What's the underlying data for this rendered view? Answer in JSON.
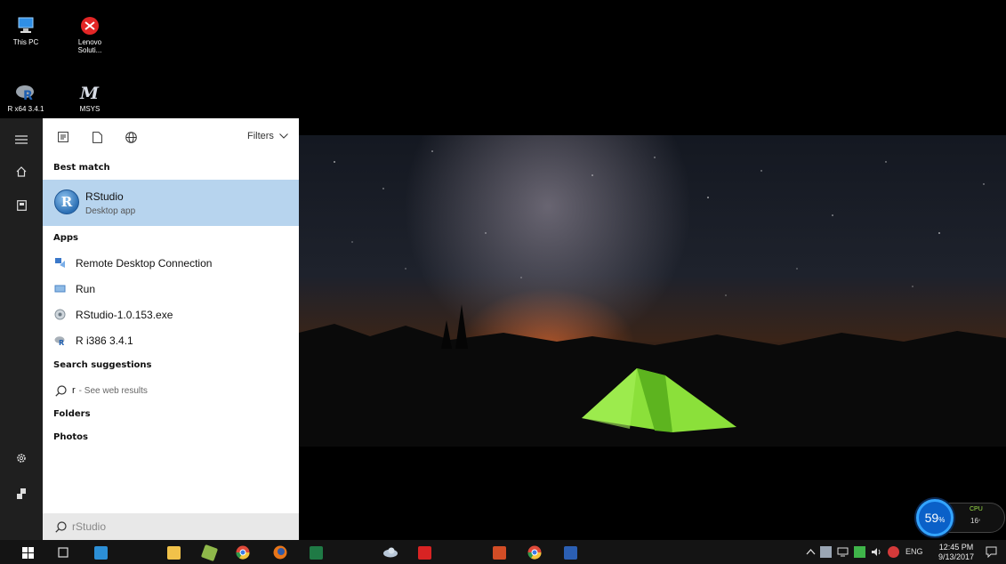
{
  "desktop_icons": [
    {
      "label": "This PC",
      "icon": "this-pc-icon"
    },
    {
      "label": "Lenovo Soluti...",
      "icon": "lenovo-solutions-icon"
    },
    {
      "label": "R x64 3.4.1",
      "icon": "r-icon"
    },
    {
      "label": "MSYS",
      "icon": "msys-icon"
    }
  ],
  "start_menu": {
    "rail": [
      "hamburger-icon",
      "home-icon",
      "documents-icon",
      "settings-icon",
      "user-icon"
    ],
    "filter_tabs": [
      "apps-filter-icon",
      "documents-filter-icon",
      "web-filter-icon"
    ],
    "filters_label": "Filters",
    "best_match_heading": "Best match",
    "best_match": {
      "title": "RStudio",
      "subtitle": "Desktop app"
    },
    "apps_heading": "Apps",
    "apps": [
      {
        "label": "Remote Desktop Connection",
        "icon": "remote-desktop-icon"
      },
      {
        "label": "Run",
        "icon": "run-icon"
      },
      {
        "label": "RStudio-1.0.153.exe",
        "icon": "installer-icon"
      },
      {
        "label": "R i386 3.4.1",
        "icon": "r-icon"
      }
    ],
    "search_suggestions_heading": "Search suggestions",
    "web_suggestion": {
      "query": "r",
      "suffix": "- See web results"
    },
    "folders_heading": "Folders",
    "photos_heading": "Photos",
    "search_box": {
      "value": "rStudio"
    }
  },
  "cpu_widget": {
    "percent": "59",
    "percent_unit": "%",
    "label": "CPU",
    "temp": "16",
    "temp_unit": "°"
  },
  "taskbar": {
    "apps": [
      "start-button",
      "task-view",
      "media-player",
      "file-explorer",
      "clipboard-app",
      "chrome",
      "firefox",
      "excel",
      "cloud-app",
      "acrobat",
      "powerpoint",
      "chrome-2",
      "word"
    ],
    "tray_language": "ENG",
    "time": "12:45 PM",
    "date": "9/13/2017"
  },
  "colors": {
    "menu_bg": "#ffffff",
    "rail_bg": "#1f1f1f",
    "highlight": "#b7d4ee",
    "taskbar": "#141414"
  }
}
